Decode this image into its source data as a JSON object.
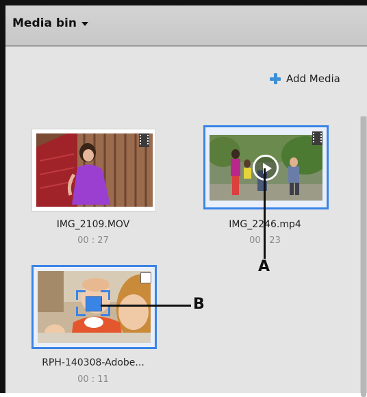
{
  "header": {
    "title": "Media bin",
    "dropdown_icon": "caret-down-icon"
  },
  "toolbar": {
    "add_media_label": "Add Media",
    "add_media_icon": "plus-icon"
  },
  "clips": [
    {
      "name": "IMG_2109.MOV",
      "duration": "00 : 27",
      "type_icon": "film-icon",
      "selected": false
    },
    {
      "name": "IMG_2246.mp4",
      "duration": "00 : 23",
      "type_icon": "film-icon",
      "selected": true
    },
    {
      "name": "RPH-140308-Adobe...",
      "duration": "00 : 11",
      "type_icon": "photo-icon",
      "selected": true
    }
  ],
  "callouts": {
    "a": "A",
    "b": "B"
  },
  "colors": {
    "selection": "#3a84e6",
    "panel_bg": "#e4e4e4",
    "header_bg": "#cbcbcb"
  }
}
